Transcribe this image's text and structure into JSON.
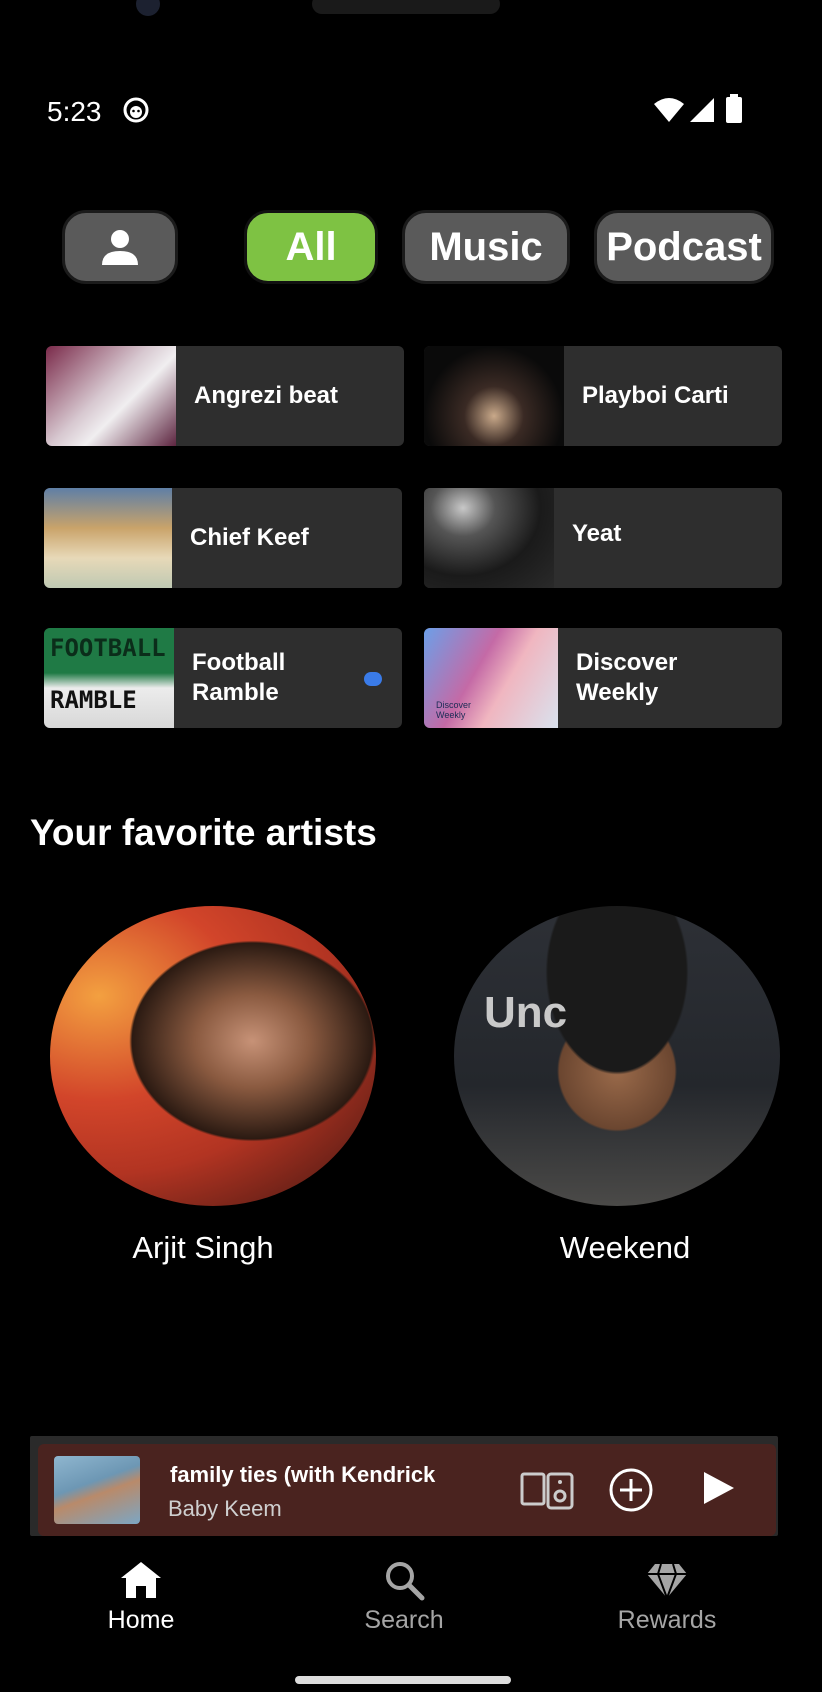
{
  "status_bar": {
    "time": "5:23"
  },
  "filters": {
    "chips": [
      "All",
      "Music",
      "Podcast"
    ],
    "selected": "All",
    "accent_color": "#7ec243"
  },
  "shortcuts": [
    {
      "label": "Angrezi beat"
    },
    {
      "label": "Playboi Carti"
    },
    {
      "label": "Chief Keef"
    },
    {
      "label": "Yeat"
    },
    {
      "label": "Football Ramble",
      "art_text_top": "FOOTBALL",
      "art_text_bottom": "RAMBLE"
    },
    {
      "label": "Discover Weekly",
      "art_text": "Discover Weekly"
    }
  ],
  "favorites": {
    "title": "Your favorite artists",
    "artists": [
      {
        "name": "Arjit Singh"
      },
      {
        "name": "Weekend",
        "photo_text": "Unc"
      }
    ]
  },
  "now_playing": {
    "title": "family ties (with Kendrick",
    "artist": "Baby Keem",
    "background_color": "#4a231f"
  },
  "bottom_nav": {
    "items": [
      {
        "label": "Home",
        "icon": "home-icon",
        "active": true
      },
      {
        "label": "Search",
        "icon": "search-icon",
        "active": false
      },
      {
        "label": "Rewards",
        "icon": "diamond-icon",
        "active": false
      }
    ]
  }
}
